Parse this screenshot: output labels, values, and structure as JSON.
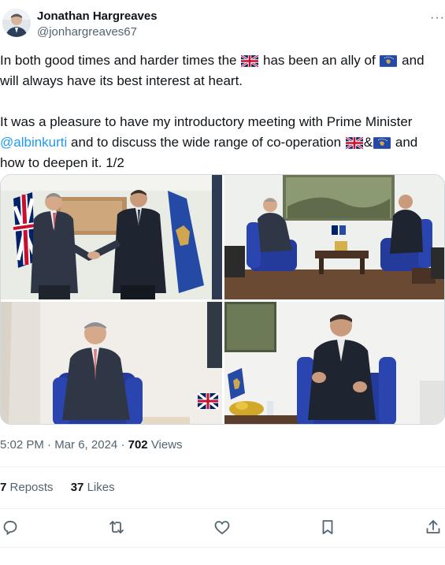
{
  "author": {
    "name": "Jonathan Hargreaves",
    "handle": "@jonhargreaves67"
  },
  "tweet": {
    "line1_a": "In both good times and harder times the",
    "line1_b": "has been an ally of",
    "line1_c": "and will always have its best interest at heart.",
    "para2_a": "It was a pleasure to have my introductory meeting with Prime Minister",
    "mention": "@albinkurti",
    "para2_b": "and to discuss the wide range of co-operation",
    "para2_amp": "&",
    "para2_c": "and how to deepen it.  1/2"
  },
  "meta": {
    "time": "5:02 PM",
    "date": "Mar 6, 2024",
    "views_count": "702",
    "views_label": "Views"
  },
  "stats": {
    "reposts_count": "7",
    "reposts_label": "Reposts",
    "likes_count": "37",
    "likes_label": "Likes"
  },
  "icons": {
    "more": "more-icon",
    "reply": "reply-icon",
    "repost": "repost-icon",
    "like": "like-icon",
    "bookmark": "bookmark-icon",
    "share": "share-icon",
    "uk_flag": "uk-flag-icon",
    "kosovo_flag": "kosovo-flag-icon"
  },
  "colors": {
    "link": "#1d9bf0",
    "secondary_text": "#536471",
    "primary_text": "#0f1419"
  }
}
